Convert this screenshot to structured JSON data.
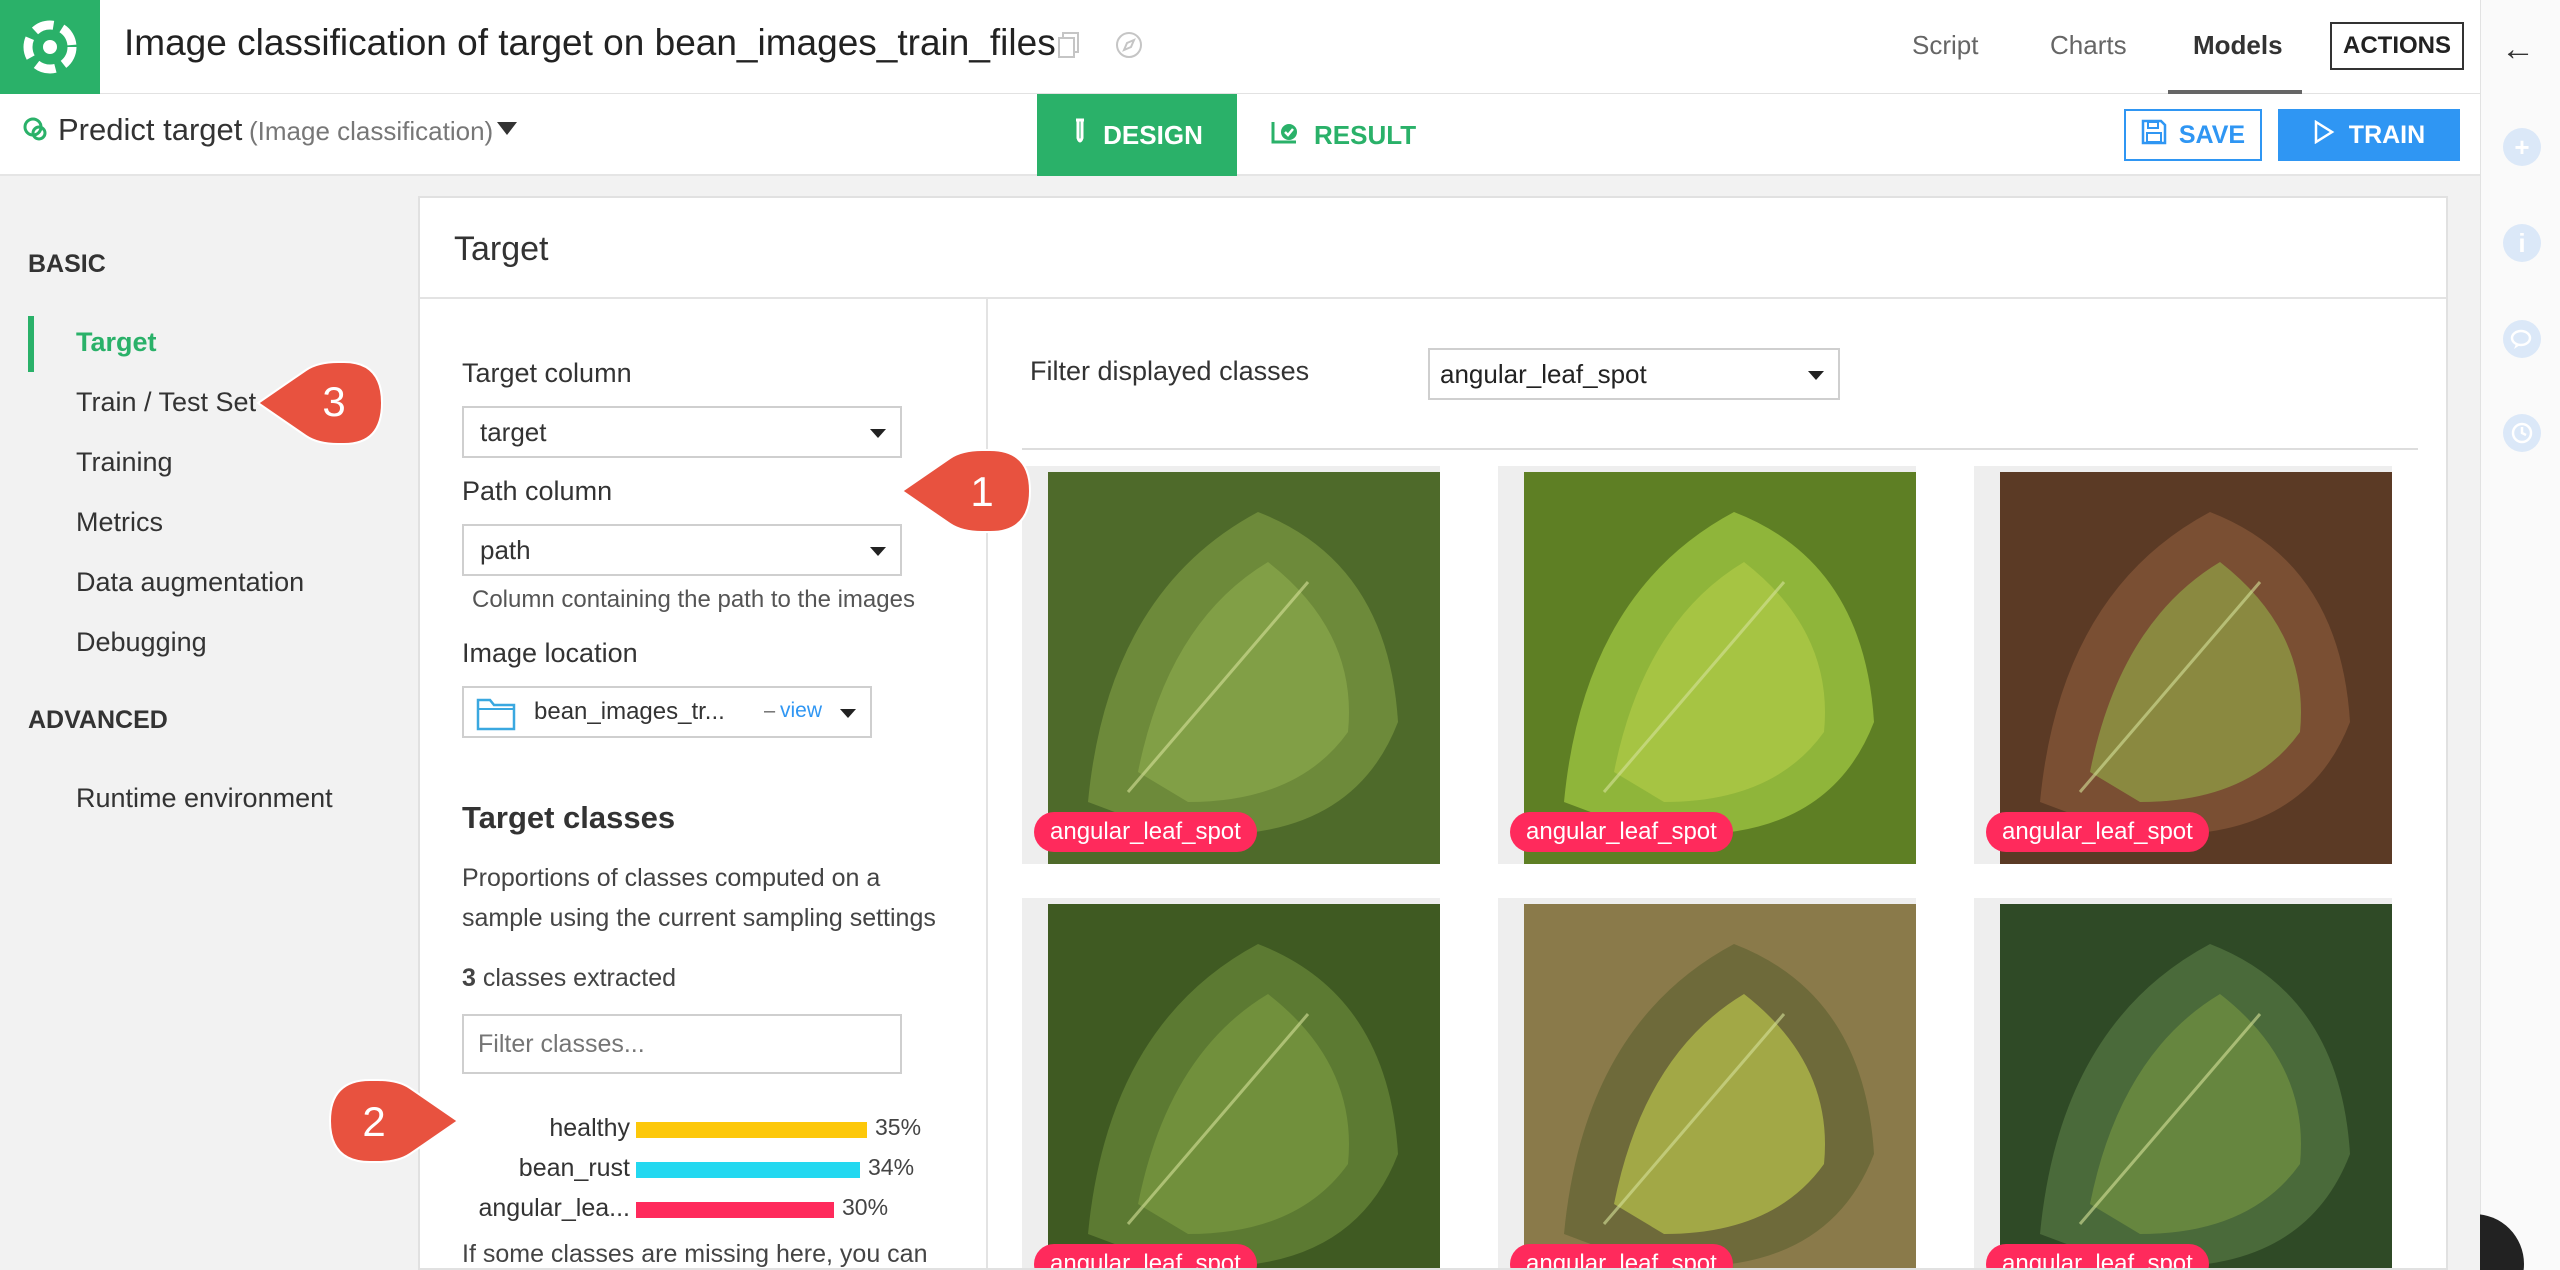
{
  "header": {
    "title": "Image classification of target on bean_images_train_files",
    "tabs": [
      "Script",
      "Charts",
      "Models"
    ],
    "actions_label": "ACTIONS"
  },
  "subheader": {
    "title": "Predict target",
    "subtitle": "(Image classification)",
    "design_label": "DESIGN",
    "result_label": "RESULT",
    "save_label": "SAVE",
    "train_label": "TRAIN"
  },
  "sidebar": {
    "basic_heading": "BASIC",
    "basic_items": [
      "Target",
      "Train / Test Set",
      "Training",
      "Metrics",
      "Data augmentation",
      "Debugging"
    ],
    "advanced_heading": "ADVANCED",
    "advanced_items": [
      "Runtime environment"
    ]
  },
  "panel": {
    "title": "Target",
    "target_column_label": "Target column",
    "target_column_value": "target",
    "path_column_label": "Path column",
    "path_column_value": "path",
    "path_column_help": "Column containing the path to the images",
    "image_location_label": "Image location",
    "image_location_value": "bean_images_tr...",
    "image_location_dash": "–",
    "image_location_link": "view",
    "target_classes_heading": "Target classes",
    "proportions_line1": "Proportions of classes computed on a",
    "proportions_line2": "sample using the current sampling settings",
    "classes_count": "3",
    "classes_extracted": "classes extracted",
    "filter_placeholder": "Filter classes...",
    "missing_note": "If some classes are missing here, you can"
  },
  "classes": [
    {
      "name": "healthy",
      "percent": 35,
      "label": "35%",
      "color": "#fdc80a"
    },
    {
      "name": "bean_rust",
      "percent": 34,
      "label": "34%",
      "color": "#23d8f0"
    },
    {
      "name": "angular_lea...",
      "percent": 30,
      "label": "30%",
      "color": "#ff2a5c"
    }
  ],
  "gallery": {
    "filter_label": "Filter displayed classes",
    "filter_value": "angular_leaf_spot",
    "image_label": "angular_leaf_spot"
  },
  "callouts": [
    "1",
    "2",
    "3"
  ],
  "colors": {
    "brand_green": "#2ab169",
    "primary_blue": "#2f96f3",
    "label_pink": "#ff2a5c",
    "callout_red": "#e8523f"
  }
}
